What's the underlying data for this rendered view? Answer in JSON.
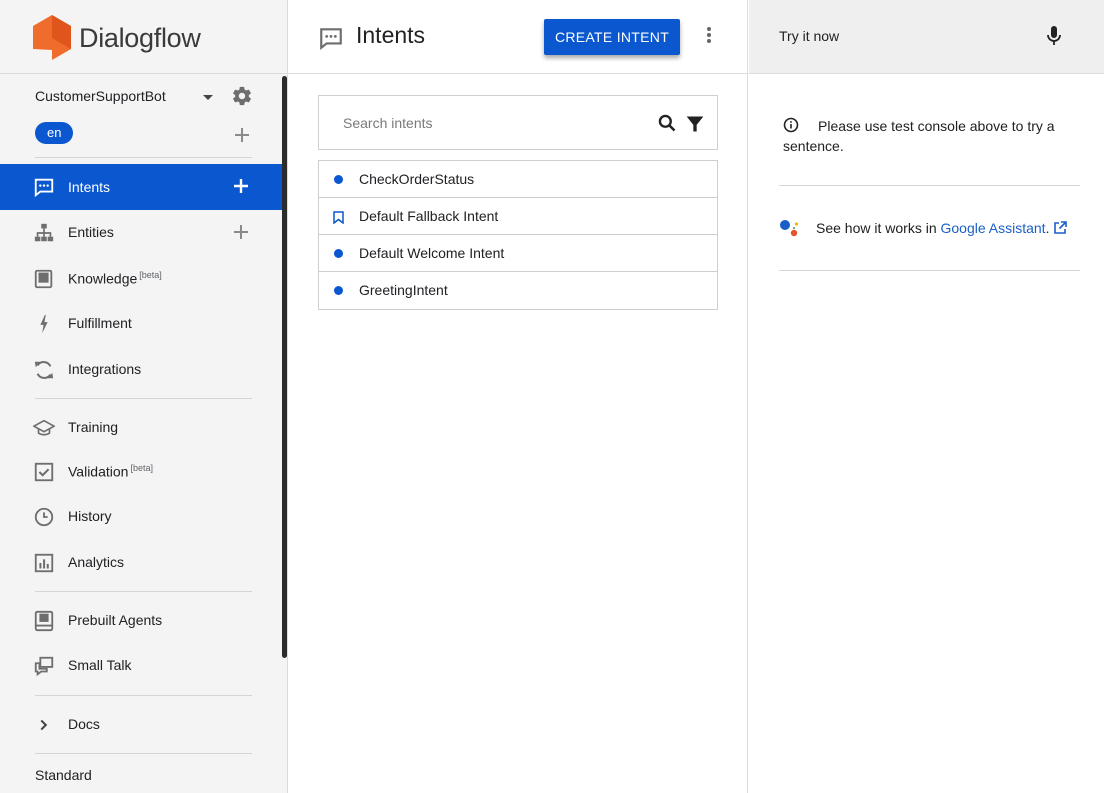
{
  "brand": {
    "name": "Dialogflow",
    "accent": "#0b57d0",
    "logo_color": "#ef6c2c"
  },
  "sidebar": {
    "agent_name": "CustomerSupportBot",
    "language": "en",
    "items": [
      {
        "label": "Intents",
        "icon": "chat-icon",
        "active": true,
        "has_add": true
      },
      {
        "label": "Entities",
        "icon": "sitemap-icon",
        "has_add": true
      },
      {
        "label": "Knowledge",
        "badge": "[beta]",
        "icon": "book-icon"
      },
      {
        "label": "Fulfillment",
        "icon": "bolt-icon"
      },
      {
        "label": "Integrations",
        "icon": "sync-icon"
      },
      {
        "label": "Training",
        "icon": "graduation-cap-icon"
      },
      {
        "label": "Validation",
        "badge": "[beta]",
        "icon": "checkbox-icon"
      },
      {
        "label": "History",
        "icon": "clock-icon"
      },
      {
        "label": "Analytics",
        "icon": "bar-chart-icon"
      },
      {
        "label": "Prebuilt Agents",
        "icon": "agent-book-icon"
      },
      {
        "label": "Small Talk",
        "icon": "chat-bubbles-icon"
      },
      {
        "label": "Docs",
        "icon": "chevron-right-icon"
      }
    ],
    "plan": "Standard"
  },
  "main": {
    "title": "Intents",
    "create_button": "CREATE INTENT",
    "search_placeholder": "Search intents",
    "intents": [
      {
        "name": "CheckOrderStatus",
        "marker": "dot"
      },
      {
        "name": "Default Fallback Intent",
        "marker": "bookmark"
      },
      {
        "name": "Default Welcome Intent",
        "marker": "dot"
      },
      {
        "name": "GreetingIntent",
        "marker": "dot"
      }
    ]
  },
  "try_panel": {
    "label": "Try it now",
    "info": "Please use test console above to try a sentence.",
    "assistant_prefix": "See how it works in ",
    "assistant_link": "Google Assistant",
    "assistant_suffix": "."
  }
}
